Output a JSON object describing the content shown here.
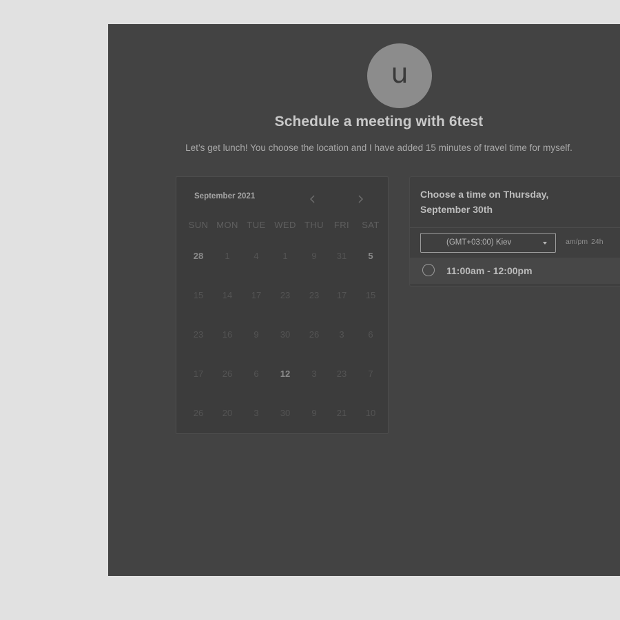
{
  "host": {
    "avatar_initial": "u",
    "title": "Schedule a meeting with 6test",
    "description": "Let’s get lunch! You choose the location and I have added 15 minutes of travel time for myself."
  },
  "calendar": {
    "month_label": "September 2021",
    "prev_icon": "chevron-left-icon",
    "next_icon": "chevron-right-icon",
    "weekdays": [
      "SUN",
      "MON",
      "TUE",
      "WED",
      "THU",
      "FRI",
      "SAT"
    ],
    "weeks": [
      [
        "28",
        "1",
        "4",
        "1",
        "9",
        "31",
        "5"
      ],
      [
        "15",
        "14",
        "17",
        "23",
        "23",
        "17",
        "15"
      ],
      [
        "23",
        "16",
        "9",
        "30",
        "26",
        "3",
        "6"
      ],
      [
        "17",
        "26",
        "6",
        "12",
        "3",
        "23",
        "7"
      ],
      [
        "26",
        "20",
        "3",
        "30",
        "9",
        "21",
        "10"
      ]
    ]
  },
  "time_panel": {
    "heading": "Choose a time on Thursday, September 30th",
    "timezone": "(GMT+03:00) Kiev",
    "format_ampm": "am/pm",
    "format_24h": "24h",
    "slots": [
      "11:00am - 12:00pm"
    ]
  }
}
